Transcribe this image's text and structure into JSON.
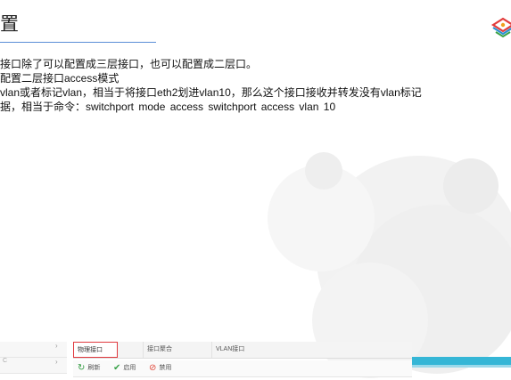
{
  "slide": {
    "title": "置",
    "lines": [
      "接口除了可以配置成三层接口，也可以配置成二层口。",
      "配置二层接口access模式",
      "vlan或者标记vlan，相当于将接口eth2划进vlan10，那么这个接口接收并转发没有vlan标记",
      "据，相当于命令：switchport mode access   switchport access vlan 10"
    ]
  },
  "embedded_ui": {
    "tabs": [
      {
        "label": "物理接口",
        "active": true
      },
      {
        "label": "接口聚合",
        "active": false
      },
      {
        "label": "VLAN接口",
        "active": false
      }
    ],
    "toolbar": {
      "refresh_label": "刷新",
      "enable_label": "启用",
      "disable_label": "禁用"
    },
    "left_menu": [
      {
        "label": "",
        "arrow": "›"
      },
      {
        "label": "C",
        "arrow": "›"
      }
    ]
  },
  "colors": {
    "title_underline": "#5b8ed6",
    "active_tab_border": "#e0393e",
    "teal_bar": "#35b6d6",
    "refresh_icon": "#2f9a3e",
    "enable_icon": "#3aa34a",
    "disable_icon": "#e04a3c"
  }
}
